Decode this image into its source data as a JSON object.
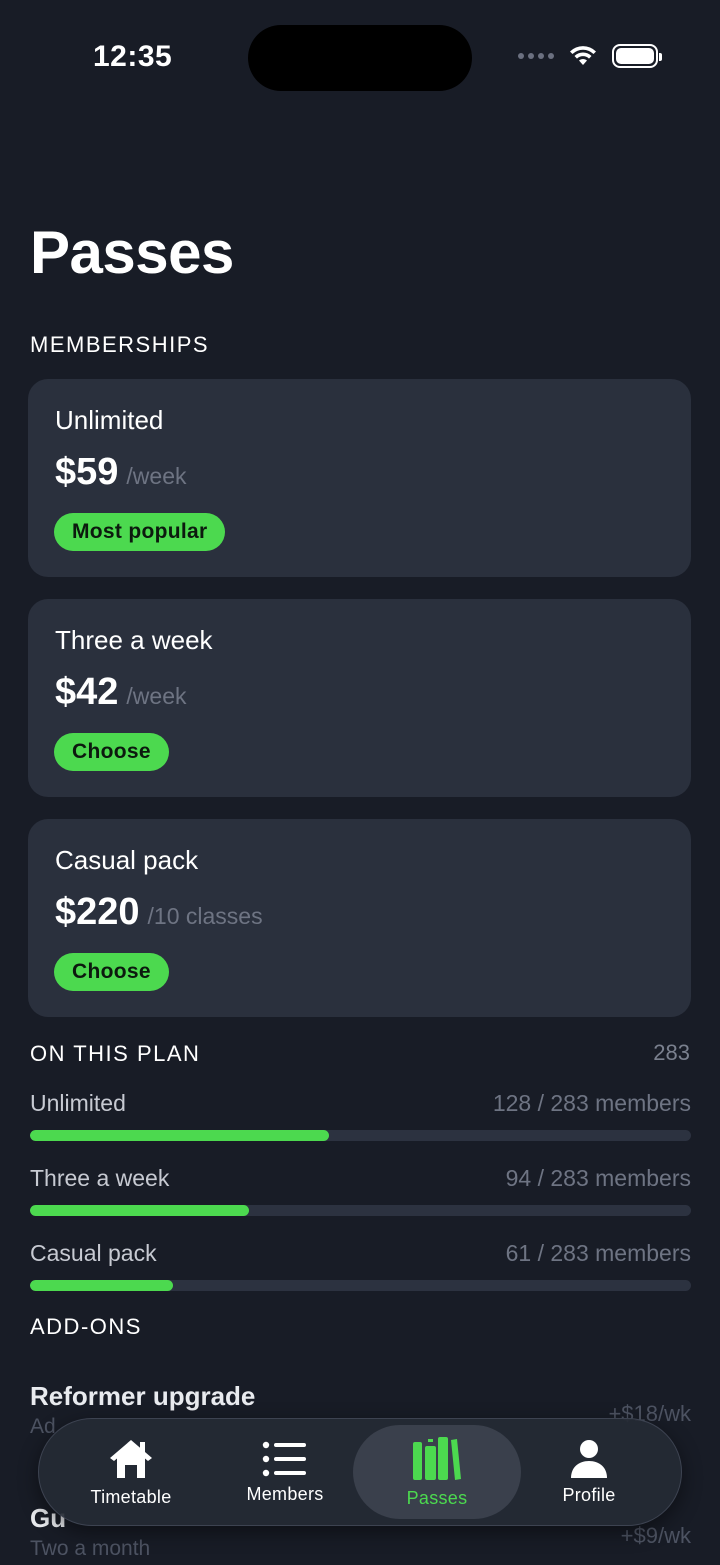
{
  "status_bar": {
    "time": "12:35",
    "icons": [
      "signal-dots-icon",
      "wifi-icon",
      "battery-icon"
    ]
  },
  "page": {
    "title": "Passes"
  },
  "memberships": {
    "heading": "MEMBERSHIPS",
    "items": [
      {
        "name": "Unlimited",
        "price": "$59",
        "unit": "/week",
        "button": "Most popular"
      },
      {
        "name": "Three a week",
        "price": "$42",
        "unit": "/week",
        "button": "Choose"
      },
      {
        "name": "Casual pack",
        "price": "$220",
        "unit": "/10 classes",
        "button": "Choose"
      }
    ]
  },
  "on_plan": {
    "heading": "ON THIS PLAN",
    "total": "283",
    "rows": [
      {
        "label": "Unlimited",
        "count": "128 / 283 members",
        "fraction": 0.452
      },
      {
        "label": "Three a week",
        "count": "94 / 283 members",
        "fraction": 0.332
      },
      {
        "label": "Casual pack",
        "count": "61 / 283 members",
        "fraction": 0.216
      }
    ]
  },
  "addons": {
    "heading": "ADD-ONS",
    "items": [
      {
        "title": "Reformer upgrade",
        "subtitle": "Ad",
        "price": "+$18/wk"
      },
      {
        "title": "Gu",
        "subtitle": "Two a month",
        "price": "+$9/wk"
      }
    ]
  },
  "tabbar": {
    "tabs": [
      {
        "label": "Timetable",
        "icon": "house-icon"
      },
      {
        "label": "Members",
        "icon": "list-icon"
      },
      {
        "label": "Passes",
        "icon": "books-icon",
        "active": true
      },
      {
        "label": "Profile",
        "icon": "person-icon"
      }
    ]
  },
  "colors": {
    "background": "#181c26",
    "card": "#2a303d",
    "accent": "#4cd94f",
    "muted": "#6e7483"
  }
}
